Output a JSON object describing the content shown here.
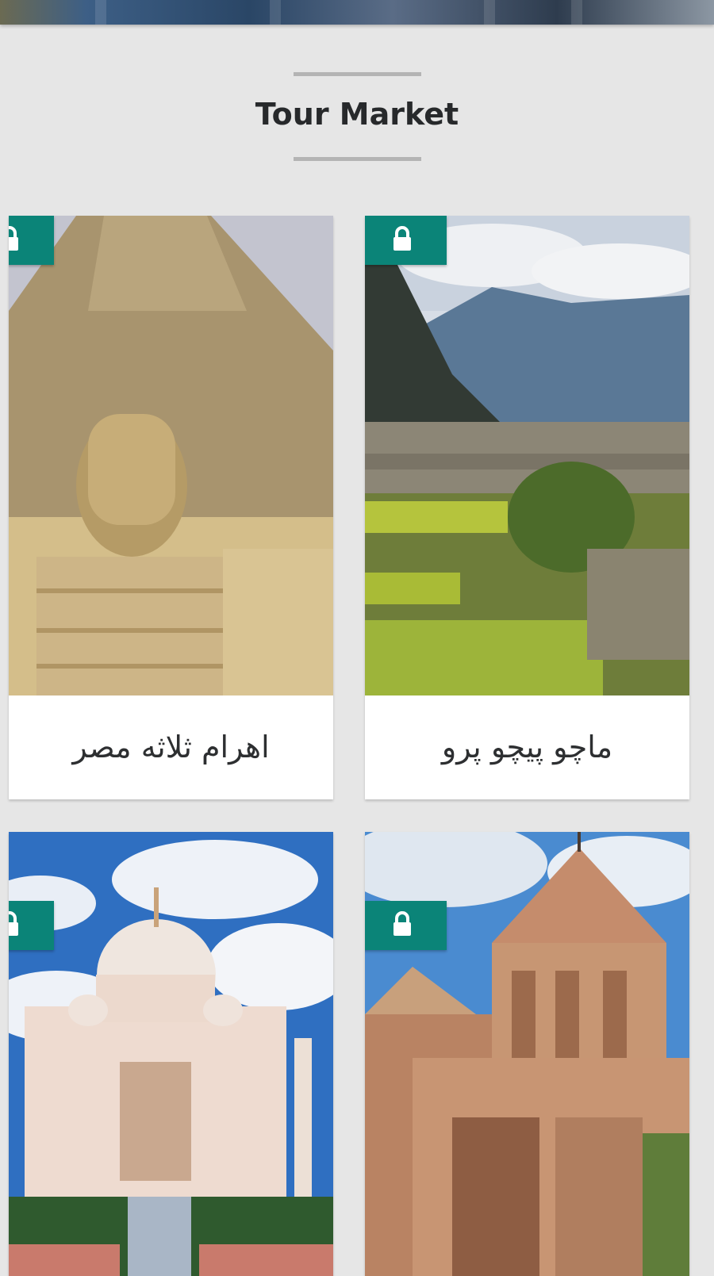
{
  "header": {
    "title": "Tour Market"
  },
  "tours": [
    {
      "name": "اهرام ثلاثه مصر",
      "locked": true,
      "image": "pyramids-sphinx"
    },
    {
      "name": "ماچو پیچو پرو",
      "locked": true,
      "image": "machu-picchu"
    },
    {
      "name": "",
      "locked": true,
      "image": "taj-mahal"
    },
    {
      "name": "",
      "locked": true,
      "image": "armenian-monastery"
    }
  ],
  "colors": {
    "background": "#e6e6e6",
    "lock_badge": "#0b8478",
    "divider": "#b4b4b4",
    "title": "#27292b"
  },
  "icons": {
    "lock": "lock-icon"
  }
}
